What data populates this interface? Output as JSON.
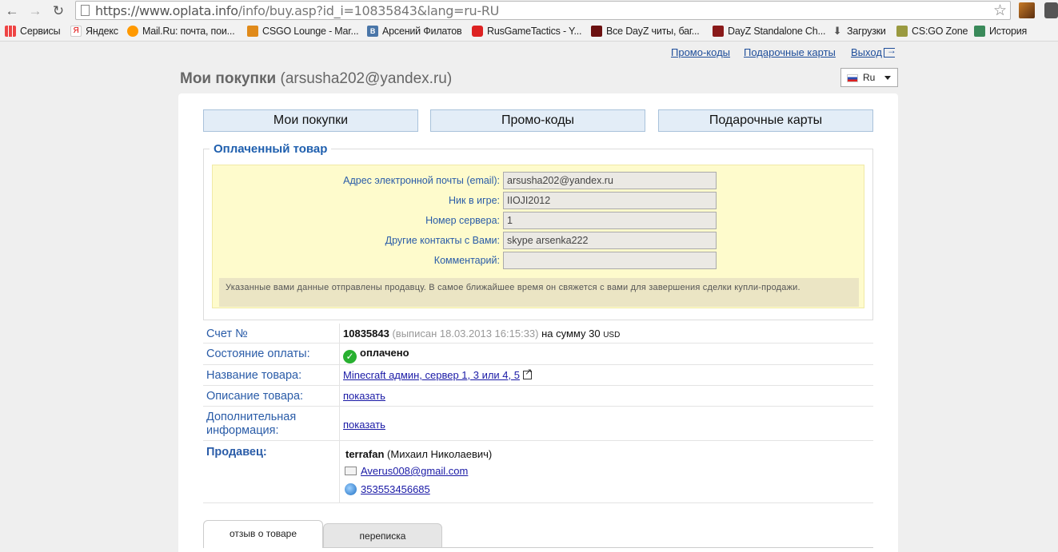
{
  "browser": {
    "url_main": "https://www.oplata.info",
    "url_path": "/info/buy.asp?id_i=10835843&lang=ru-RU",
    "bookmarks": [
      {
        "label": "Сервисы",
        "icon": "apps-icon"
      },
      {
        "label": "Яндекс",
        "icon": "yandex-icon"
      },
      {
        "label": "Mail.Ru: почта, пои...",
        "icon": "mailru-icon"
      },
      {
        "label": "CSGO Lounge - Mar...",
        "icon": "csgo-lounge-icon"
      },
      {
        "label": "Арсений Филатов",
        "icon": "vk-icon"
      },
      {
        "label": "RusGameTactics - Y...",
        "icon": "youtube-icon"
      },
      {
        "label": "Все DayZ читы, баг...",
        "icon": "dayz-cheats-icon"
      },
      {
        "label": "DayZ Standalone Ch...",
        "icon": "dayz-standalone-icon"
      },
      {
        "label": "Загрузки",
        "icon": "download-icon"
      },
      {
        "label": "CS:GO Zone",
        "icon": "csgo-zone-icon"
      },
      {
        "label": "История",
        "icon": "history-icon"
      }
    ]
  },
  "header": {
    "links": {
      "promo": "Промо-коды",
      "gift": "Подарочные карты",
      "exit": "Выход"
    },
    "title": "Мои покупки",
    "email": "(arsusha202@yandex.ru)",
    "lang": "Ru"
  },
  "tabs": [
    "Мои покупки",
    "Промо-коды",
    "Подарочные карты"
  ],
  "paid": {
    "legend": "Оплаченный товар",
    "fields": [
      {
        "label": "Адрес электронной почты (email):",
        "value": "arsusha202@yandex.ru"
      },
      {
        "label": "Ник в игре:",
        "value": "IIOJI2012"
      },
      {
        "label": "Номер сервера:",
        "value": "1"
      },
      {
        "label": "Другие контакты с Вами:",
        "value": "skype arsenka222"
      },
      {
        "label": "Комментарий:",
        "value": ""
      }
    ],
    "notice": "Указанные вами данные отправлены продавцу. В самое ближайшее время он свяжется с вами для завершения сделки купли-продажи."
  },
  "invoice": {
    "labels": {
      "account": "Счет №",
      "status": "Состояние оплаты:",
      "product": "Название товара:",
      "description": "Описание товара:",
      "additional": "Дополнительная информация:",
      "seller": "Продавец:"
    },
    "number": "10835843",
    "issued": "(выписан 18.03.2013 16:15:33)",
    "sum_text": "на сумму 30",
    "currency": "USD",
    "status": "оплачено",
    "product_name": "Minecraft админ, сервер 1, 3 или 4, 5",
    "show": "показать",
    "seller_nick": "terrafan",
    "seller_name": "(Михаил Николаевич)",
    "seller_email": "Averus008@gmail.com",
    "seller_wmid": "353553456685"
  },
  "bottom_tabs": [
    "отзыв о товаре",
    "переписка"
  ]
}
